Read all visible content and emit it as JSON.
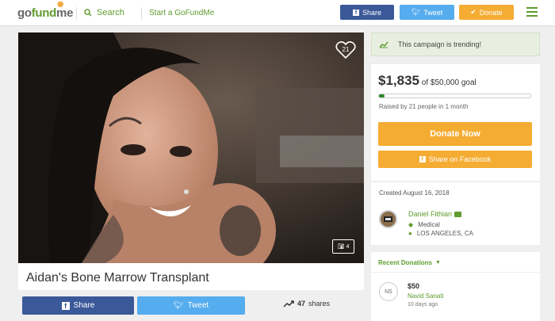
{
  "header": {
    "logo_text_a": "go",
    "logo_text_b": "fund",
    "logo_text_c": "me",
    "search_label": "Search",
    "start_label": "Start a GoFundMe",
    "share_label": "Share",
    "tweet_label": "Tweet",
    "donate_label": "Donate"
  },
  "campaign": {
    "title": "Aidan's Bone Marrow Transplant",
    "heart_count": "21",
    "photo_count": "4",
    "share_label": "Share",
    "tweet_label": "Tweet",
    "shares_count": "47",
    "shares_label": "shares"
  },
  "sidebar": {
    "trending_text": "This campaign is trending!",
    "raised_amount": "$1,835",
    "goal_text": "of $50,000 goal",
    "progress_fraction": 0.0367,
    "raised_by": "Raised by 21 people in 1 month",
    "donate_now_label": "Donate Now",
    "share_fb_label": "Share on Facebook",
    "created": "Created August 16, 2018",
    "organizer_name": "Daniel Fithian",
    "category": "Medical",
    "location": "LOS ANGELES, CA",
    "recent_label": "Recent Donations",
    "donation": {
      "initials": "NS",
      "amount": "$50",
      "name": "Navid Sanati",
      "time": "10 days ago"
    }
  },
  "colors": {
    "brand_green": "#5e9c2e",
    "facebook": "#3b5998",
    "twitter": "#55acee",
    "donate": "#f5ac33"
  }
}
